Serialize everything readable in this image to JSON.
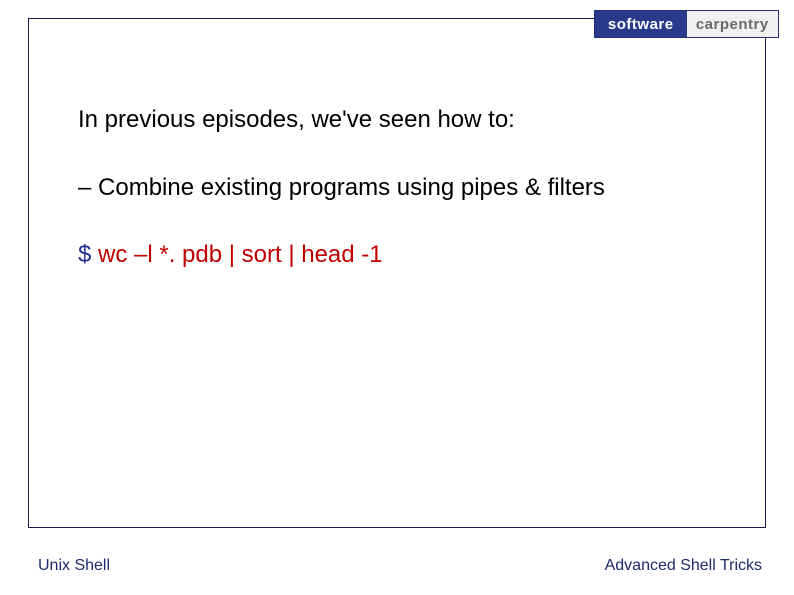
{
  "logo": {
    "left": "software",
    "right": "carpentry"
  },
  "body": {
    "intro": "In previous episodes, we've seen how to:",
    "bullet": "– Combine existing programs using pipes & filters",
    "prompt": "$ ",
    "command": "wc –l *. pdb | sort | head -1"
  },
  "footer": {
    "left": "Unix Shell",
    "right": "Advanced Shell Tricks"
  }
}
